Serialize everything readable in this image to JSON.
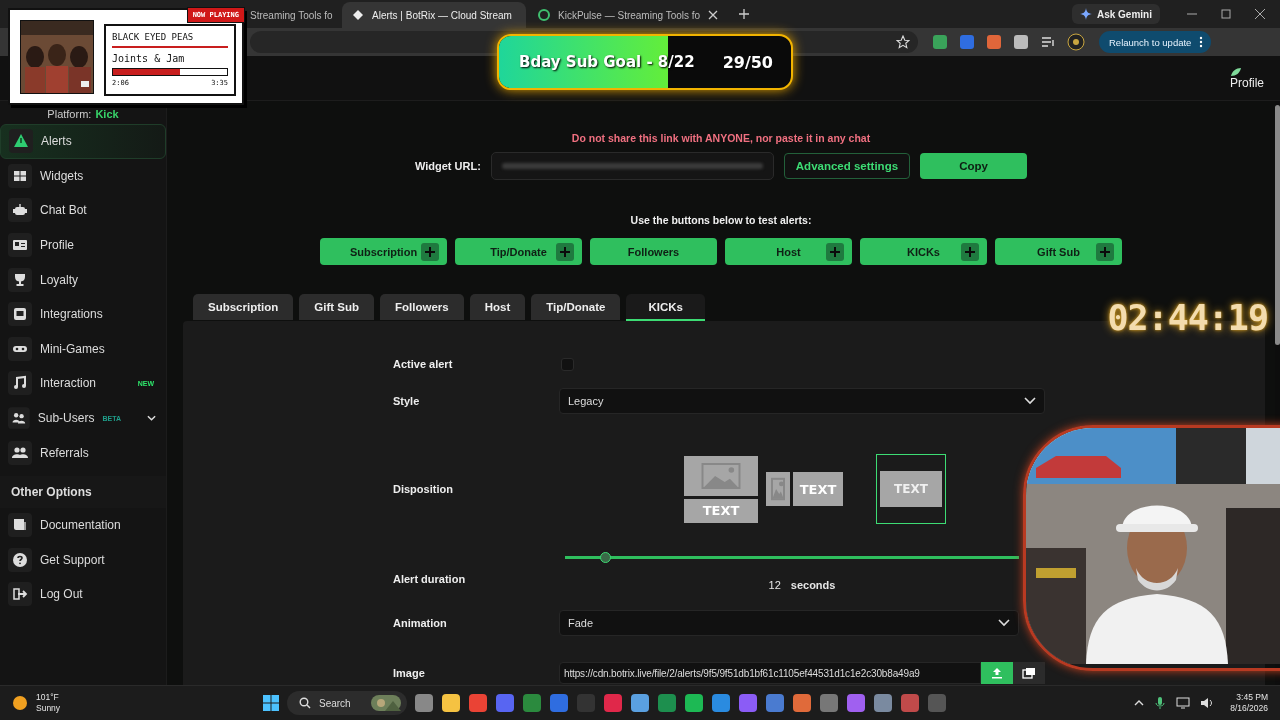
{
  "browser": {
    "tabs": [
      {
        "title": "Streaming Tools fo",
        "selected": false
      },
      {
        "title": "Alerts | BotRix — Cloud Stream",
        "selected": true
      },
      {
        "title": "KickPulse — Streaming Tools fo",
        "selected": false
      }
    ],
    "ask_button": "Ask Gemini",
    "relaunch_button": "Relaunch to update"
  },
  "header": {
    "profile": "Profile"
  },
  "sidebar": {
    "platform_label": "Platform:",
    "platform_value": "Kick",
    "items": [
      {
        "label": "Alerts",
        "selected": true
      },
      {
        "label": "Widgets",
        "selected": false
      },
      {
        "label": "Chat Bot",
        "selected": false
      },
      {
        "label": "Profile",
        "selected": false
      },
      {
        "label": "Loyalty",
        "selected": false
      },
      {
        "label": "Integrations",
        "selected": false
      },
      {
        "label": "Mini-Games",
        "selected": false
      },
      {
        "label": "Interaction",
        "selected": false,
        "badge": "NEW",
        "color": "#2ee66b"
      },
      {
        "label": "Sub-Users",
        "selected": false,
        "badge": "BETA",
        "color": "#1f9e8a",
        "expanded": false
      },
      {
        "label": "Referrals",
        "selected": false
      }
    ],
    "section": "Other Options",
    "other_items": [
      {
        "label": "Documentation",
        "selected": false
      },
      {
        "label": "Get Support",
        "selected": false
      },
      {
        "label": "Log Out",
        "selected": false
      }
    ]
  },
  "main": {
    "warning": "Do not share this link with ANYONE, nor paste it in any chat",
    "widget_url_label": "Widget URL:",
    "advanced_button": "Advanced settings",
    "copy_button": "Copy",
    "test_hint": "Use the buttons below to test alerts:",
    "test_buttons": [
      {
        "label": "Subscription",
        "has_plus": true
      },
      {
        "label": "Tip/Donate",
        "has_plus": true
      },
      {
        "label": "Followers",
        "has_plus": false
      },
      {
        "label": "Host",
        "has_plus": true
      },
      {
        "label": "KICKs",
        "has_plus": true
      },
      {
        "label": "Gift Sub",
        "has_plus": true
      }
    ],
    "tabs": [
      {
        "label": "Subscription",
        "selected": false
      },
      {
        "label": "Gift Sub",
        "selected": false
      },
      {
        "label": "Followers",
        "selected": false
      },
      {
        "label": "Host",
        "selected": false
      },
      {
        "label": "Tip/Donate",
        "selected": false
      },
      {
        "label": "KICKs",
        "selected": true
      }
    ],
    "form": [
      {
        "kind": "checkbox",
        "label": "Active alert",
        "checked": false
      },
      {
        "kind": "select",
        "label": "Style",
        "value": "Legacy"
      },
      {
        "kind": "disposition",
        "label": "Disposition",
        "options": [
          {
            "text": "TEXT",
            "selected": false
          },
          {
            "text": "TEXT",
            "selected": false
          },
          {
            "text": "TEXT",
            "selected": true
          }
        ]
      },
      {
        "kind": "slider",
        "label": "Alert duration",
        "level": 0.09,
        "value": "12",
        "unit": "seconds"
      },
      {
        "kind": "select",
        "label": "Animation",
        "value": "Fade"
      },
      {
        "kind": "file",
        "label": "Image",
        "value": "https://cdn.botrix.live/file/2/alerts/9f5/9f51db1bf61c1105ef44531d1c1e2c30b8a49a9"
      }
    ]
  },
  "overlays": {
    "now_playing": {
      "badge": "NOW PLAYING",
      "artist": "BLACK EYED PEAS",
      "title": "Joints & Jam",
      "level": 0.59,
      "elapsed": "2:06",
      "total": "3:35"
    },
    "goal": {
      "label": "Bday Sub Goal - 8/22",
      "count": "29/50",
      "level": 0.58
    },
    "timer": "02:44:19"
  },
  "taskbar": {
    "temperature": "101°F",
    "condition": "Sunny",
    "search": "Search",
    "time": "3:45 PM",
    "date": "8/16/2026"
  }
}
